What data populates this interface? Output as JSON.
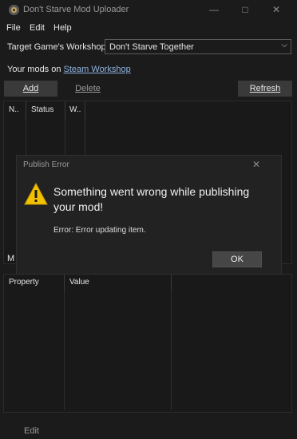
{
  "window": {
    "title": "Don't Starve Mod Uploader",
    "minimize_glyph": "—",
    "maximize_glyph": "□",
    "close_glyph": "✕",
    "icon": "dont-starve-app-icon"
  },
  "menu": {
    "items": [
      "File",
      "Edit",
      "Help"
    ]
  },
  "workshop": {
    "label": "Target Game's Workshop",
    "selected": "Don't Starve Together",
    "chevron": "⌵"
  },
  "mods": {
    "prefix": "Your mods on ",
    "link": "Steam Workshop"
  },
  "buttons": {
    "add": "Add",
    "delete": "Delete",
    "refresh": "Refresh"
  },
  "mods_table": {
    "columns": [
      "N..",
      "Status",
      "W.."
    ]
  },
  "section_label": "M",
  "properties_table": {
    "columns": [
      "Property",
      "Value"
    ]
  },
  "bottom": {
    "edit": "Edit"
  },
  "dialog": {
    "title": "Publish Error",
    "close_glyph": "✕",
    "message": "Something went wrong while publishing your mod!",
    "error": "Error: Error updating item.",
    "ok": "OK",
    "icon": "warning-icon"
  },
  "colors": {
    "background": "#1b1b1b",
    "link": "#8fb3e0",
    "warning": "#f2c200"
  }
}
